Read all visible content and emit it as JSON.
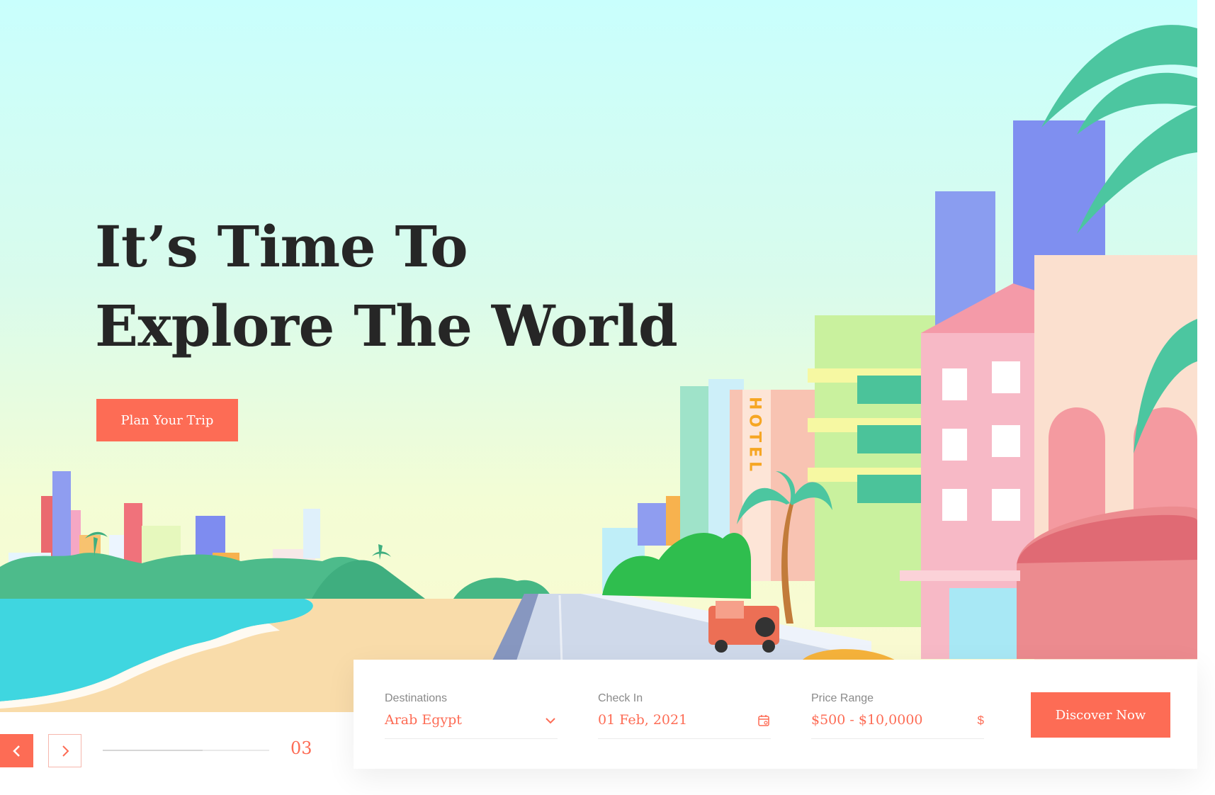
{
  "hero": {
    "headline_line1": "It’s Time To",
    "headline_line2": "Explore The World",
    "cta_label": "Plan Your Trip",
    "hotel_sign": "HOTEL"
  },
  "slider": {
    "current": "03",
    "progress": 0.6
  },
  "search": {
    "destination": {
      "label": "Destinations",
      "value": "Arab Egypt",
      "icon": "chevron-down-icon"
    },
    "check_in": {
      "label": "Check In",
      "value": "01 Feb, 2021",
      "icon": "calendar-icon"
    },
    "price_range": {
      "label": "Price Range",
      "value": "$500 - $10,0000",
      "icon": "$"
    },
    "submit_label": "Discover Now"
  },
  "colors": {
    "accent": "#fd6c55",
    "heading": "#262626",
    "sky_top": "#c9fffd",
    "sky_bottom": "#fcf9cf"
  }
}
